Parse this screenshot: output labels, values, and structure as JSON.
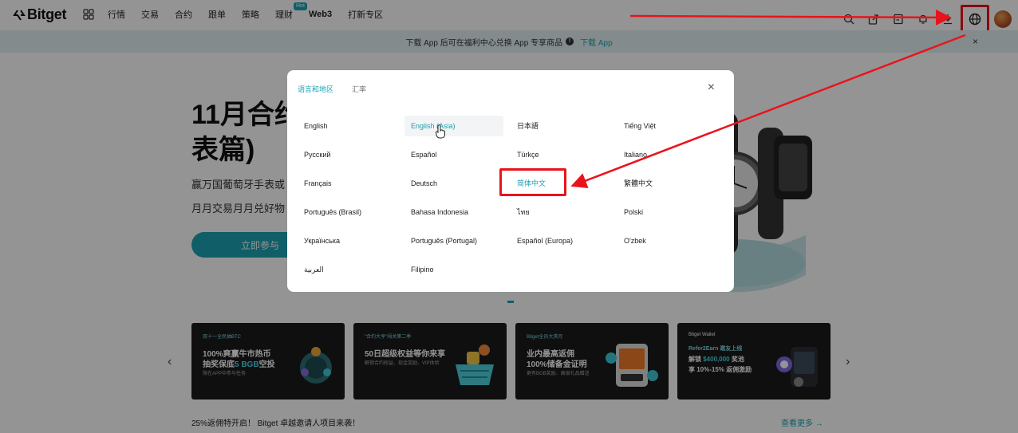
{
  "nav": {
    "logo": "Bitget",
    "items": [
      "行情",
      "交易",
      "合约",
      "跟单",
      "策略",
      "理财",
      "Web3",
      "打新专区"
    ],
    "hot_badge": "Hot"
  },
  "notice": {
    "text": "下载 App 后可在福利中心兑换 App 专享商品",
    "link": "下载 App"
  },
  "hero": {
    "title_line1": "11月合约",
    "title_line2": "表篇)",
    "subtitle1": "赢万国葡萄牙手表或",
    "subtitle2": "月月交易月月兑好物",
    "cta": "立即参与"
  },
  "modal": {
    "tabs": [
      "语言和地区",
      "汇率"
    ],
    "active_tab": "语言和地区",
    "languages": [
      [
        "English",
        "English (Asia)",
        "日本語",
        "Tiếng Việt"
      ],
      [
        "Русский",
        "Español",
        "Türkçe",
        "Italiano"
      ],
      [
        "Français",
        "Deutsch",
        "简体中文",
        "繁體中文"
      ],
      [
        "Português (Brasil)",
        "Bahasa Indonesia",
        "ไทย",
        "Polski"
      ],
      [
        "Українська",
        "Português (Portugal)",
        "Español (Europa)",
        "O'zbek"
      ],
      [
        "العربية",
        "Filipino",
        "",
        ""
      ]
    ],
    "hovered": "English (Asia)",
    "selected": "简体中文"
  },
  "cards": [
    {
      "tag": "双十一全民抽BTC",
      "h1": "100%爽赢牛市热币",
      "h2_pre": "抽奖保底",
      "h2_hl": "5 BGB",
      "h2_post": "空投",
      "small": "限在APP中参与任务"
    },
    {
      "tag": "\"合约大亨\"闯关第二季",
      "h1": "50日超级权益等你来享",
      "h2_pre": "",
      "h2_hl": "",
      "h2_post": "",
      "small": "解锁合约权益、现金奖励、VIP体验"
    },
    {
      "tag": "Bitget全员大赏月",
      "h1": "业内最高返佣",
      "h2_pre": "100%储备金证明",
      "h2_hl": "",
      "h2_post": "",
      "small": "更有BGB奖励、高级礼品赠送"
    },
    {
      "tag": "Bitget Wallet",
      "h1": "Refer2Earn 邀友上线",
      "h2_pre": "解锁 ",
      "h2_hl": "$400,000",
      "h2_post": " 奖池",
      "small": "享 10%-15% 返佣激励"
    }
  ],
  "bottom": {
    "announcement": "25%返佣特开启！ Bitget 卓越邀请人项目来袭！",
    "more": "查看更多"
  },
  "colors": {
    "accent": "#1da2b4",
    "annotation_red": "#e8141c"
  }
}
